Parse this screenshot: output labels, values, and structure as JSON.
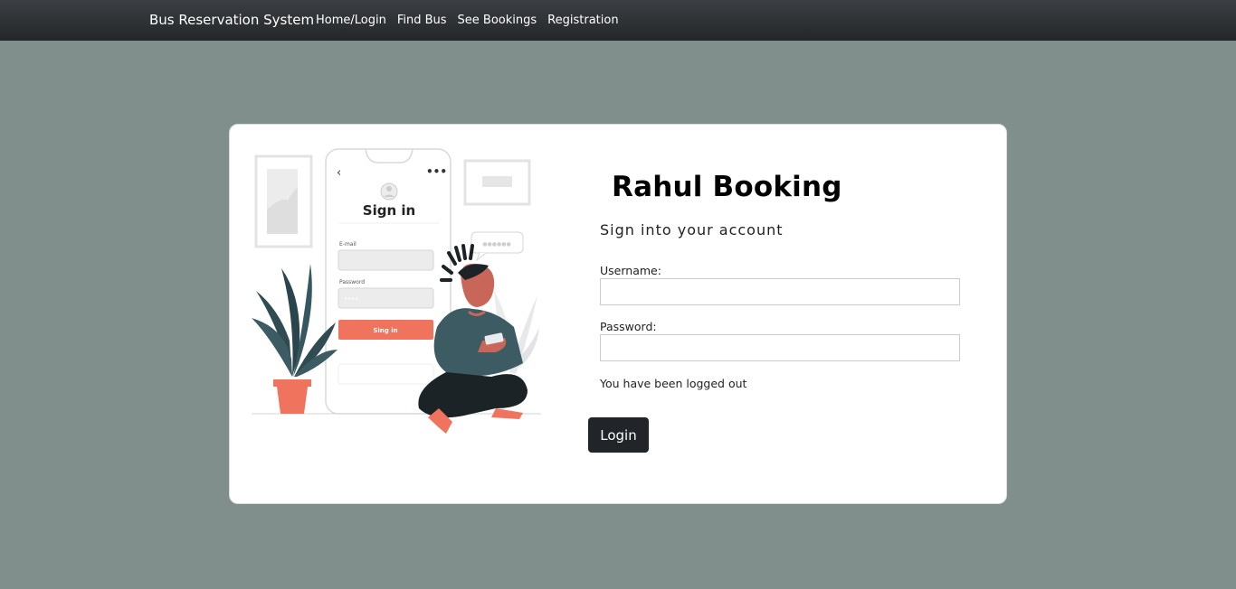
{
  "navbar": {
    "brand": "Bus Reservation System",
    "links": [
      "Home/Login",
      "Find Bus",
      "See Bookings",
      "Registration"
    ]
  },
  "illustration": {
    "phone_title": "Sign in",
    "email_label": "E-mail",
    "password_label": "Password",
    "password_dots": "••••",
    "button_label": "Sing in",
    "bubble_dots": "●●●●●●",
    "menu_dots": "•••",
    "back_arrow": "‹"
  },
  "login": {
    "title": "Rahul Booking",
    "subtitle": "Sign into your account",
    "username_label": "Username:",
    "username_value": "",
    "password_label": "Password:",
    "password_value": "",
    "message": "You have been logged out",
    "button": "Login"
  },
  "colors": {
    "page_bg": "#808f8c",
    "navbar": "#2b2e31",
    "accent": "#f0735e",
    "button": "#212529"
  }
}
